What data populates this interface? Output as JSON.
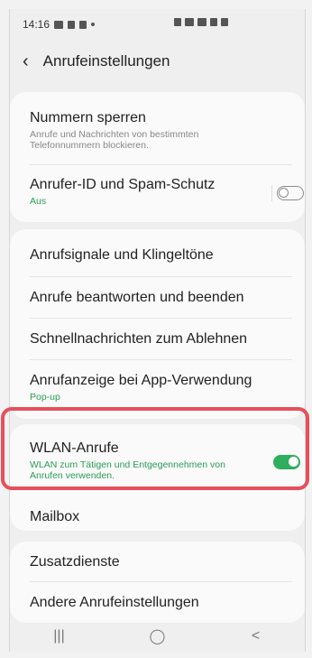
{
  "status": {
    "time": "14:16"
  },
  "header": {
    "title": "Anrufeinstellungen"
  },
  "sections": {
    "block": {
      "title": "Nummern sperren",
      "subtitle": "Anrufe und Nachrichten von bestimmten Telefonnummern blockieren."
    },
    "spam": {
      "title": "Anrufer-ID und Spam-Schutz",
      "status": "Aus",
      "toggle_on": false
    },
    "ringtones": {
      "title": "Anrufsignale und Klingeltöne"
    },
    "answer": {
      "title": "Anrufe beantworten und beenden"
    },
    "quick": {
      "title": "Schnellnachrichten zum Ablehnen"
    },
    "display": {
      "title": "Anrufanzeige bei App-Verwendung",
      "status": "Pop-up"
    },
    "wlan": {
      "title": "WLAN-Anrufe",
      "subtitle": "WLAN zum Tätigen und Entgegennehmen von Anrufen verwenden.",
      "toggle_on": true
    },
    "mailbox": {
      "title": "Mailbox"
    },
    "extra": {
      "title": "Zusatzdienste"
    },
    "other": {
      "title": "Andere Anrufeinstellungen"
    }
  },
  "colors": {
    "accent": "#2fae5d",
    "highlight": "#e5505b"
  },
  "navbar": {
    "recent": "|||",
    "home": "◯",
    "back": "<"
  }
}
